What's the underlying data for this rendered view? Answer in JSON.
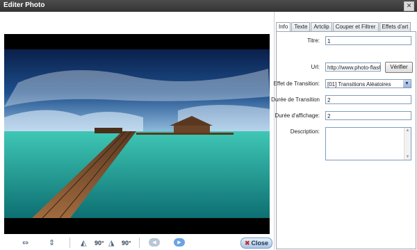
{
  "window": {
    "title": "Editer Photo",
    "close_glyph": "✕"
  },
  "tabs": [
    {
      "label": "Info",
      "active": true
    },
    {
      "label": "Texte",
      "active": false
    },
    {
      "label": "Artclip",
      "active": false
    },
    {
      "label": "Couper et Filtrer",
      "active": false
    },
    {
      "label": "Effets d'art",
      "active": false
    }
  ],
  "form": {
    "title_label": "Titre:",
    "title_value": "1",
    "url_label": "Url:",
    "url_value": "http://www.photo-flash-m",
    "verify_label": "Vérifier",
    "transition_label": "Effet de Transition:",
    "transition_value": "[01] Transitions Aléatoires",
    "transition_duration_label": "Durée de Transition",
    "transition_duration_value": "2",
    "display_duration_label": "Durée d'affichage:",
    "display_duration_value": "2",
    "description_label": "Description:",
    "description_value": ""
  },
  "toolbar": {
    "rotate_left_label": "90°",
    "rotate_right_label": "90°",
    "close_label": "Close",
    "icons": [
      "flip-horizontal-icon",
      "flip-vertical-icon",
      "rotate-left-icon",
      "rotate-right-icon",
      "previous-icon",
      "next-icon",
      "close-x-icon"
    ]
  },
  "colors": {
    "titlebar": "#3c3c3c",
    "accent": "#6aa4e4",
    "sky": "#1d4f8c",
    "water": "#2fb3a0",
    "pier": "#7a5233"
  }
}
